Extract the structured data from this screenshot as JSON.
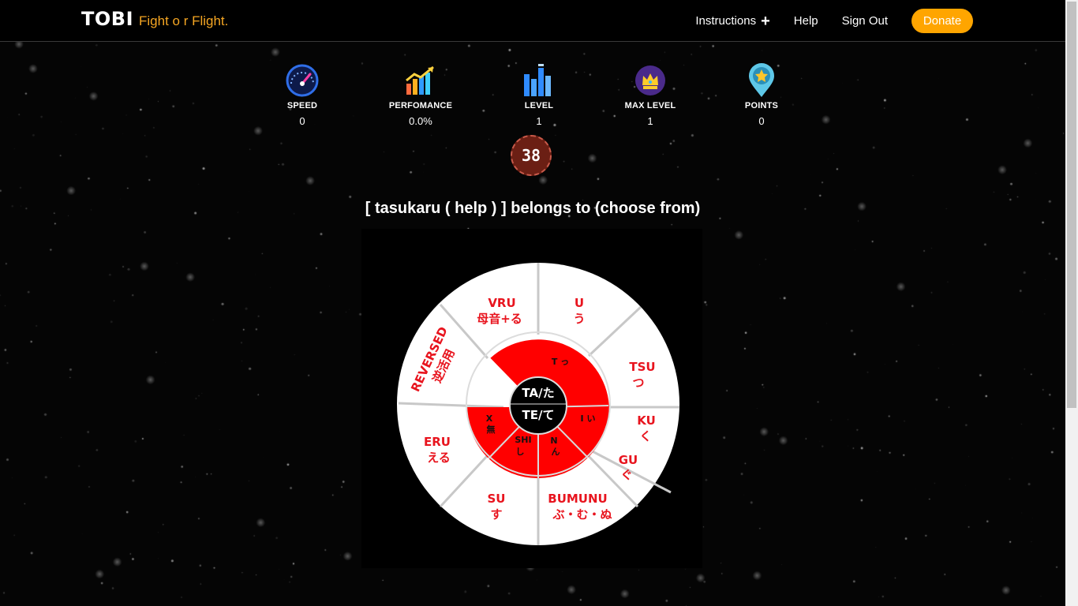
{
  "header": {
    "brand": "TOBI",
    "tagline": "Fight o r  Flight.",
    "nav": [
      {
        "label": "Instructions",
        "icon": "plus-icon"
      },
      {
        "label": "Help"
      },
      {
        "label": "Sign Out"
      }
    ],
    "donate": "Donate",
    "donate_color": "#ffa500",
    "tagline_color": "#f5a623"
  },
  "stats": [
    {
      "label": "SPEED",
      "value": "0",
      "icon": "speedometer-icon"
    },
    {
      "label": "PERFOMANCE",
      "value": "0.0%",
      "icon": "growth-chart-icon"
    },
    {
      "label": "LEVEL",
      "value": "1",
      "icon": "level-bars-icon"
    },
    {
      "label": "MAX LEVEL",
      "value": "1",
      "icon": "crown-badge-icon"
    },
    {
      "label": "POINTS",
      "value": "0",
      "icon": "star-pin-icon"
    }
  ],
  "timer": "38",
  "question": "[ tasukaru ( help ) ] belongs to (choose from)",
  "wheel": {
    "center": [
      "TA/た",
      "TE/て"
    ],
    "outer": [
      {
        "name": "u",
        "lines": [
          "U",
          "う"
        ]
      },
      {
        "name": "tsu",
        "lines": [
          "TSU",
          "つ"
        ]
      },
      {
        "name": "ku",
        "lines": [
          "KU",
          "く"
        ]
      },
      {
        "name": "gu",
        "lines": [
          "GU",
          "ぐ"
        ]
      },
      {
        "name": "bumunu",
        "lines": [
          "BUMUNU",
          "ぶ・む・ぬ"
        ]
      },
      {
        "name": "su",
        "lines": [
          "SU",
          "す"
        ]
      },
      {
        "name": "eru",
        "lines": [
          "ERU",
          "える"
        ]
      },
      {
        "name": "reversed",
        "lines": [
          "REVERSED",
          "逆活用"
        ]
      },
      {
        "name": "vru",
        "lines": [
          "VRU",
          "母音+る"
        ]
      }
    ],
    "inner": [
      {
        "name": "t",
        "text": "T っ"
      },
      {
        "name": "i",
        "text": "I い"
      },
      {
        "name": "n",
        "lines": [
          "N",
          "ん"
        ]
      },
      {
        "name": "shi",
        "lines": [
          "SHI",
          "し"
        ]
      },
      {
        "name": "x",
        "lines": [
          "X",
          "無"
        ]
      }
    ],
    "colors": {
      "outer": "#ffffff",
      "inner": "#ff0000",
      "text": "#e8141e",
      "center": "#000000",
      "divider": "#c8c8c8"
    }
  }
}
